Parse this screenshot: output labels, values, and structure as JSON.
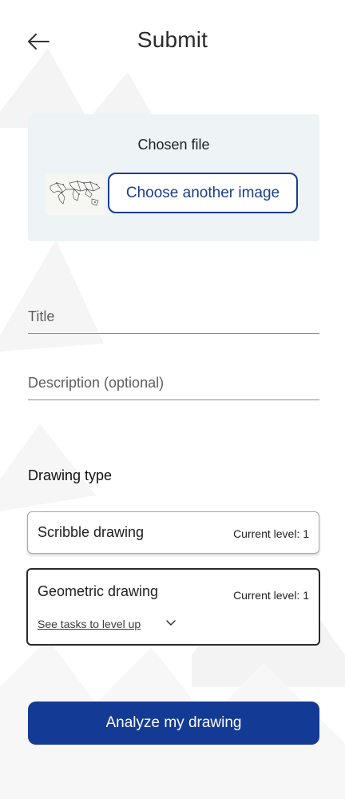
{
  "header": {
    "title": "Submit",
    "back_icon": "arrow-left-icon"
  },
  "file_panel": {
    "label": "Chosen file",
    "thumbnail_icon": "world-map-thumbnail",
    "choose_button_label": "Choose another image"
  },
  "form": {
    "title_placeholder": "Title",
    "description_placeholder": "Description (optional)"
  },
  "drawing_type": {
    "label": "Drawing type",
    "options": [
      {
        "name": "Scribble drawing",
        "level": "Current level: 1",
        "selected": false
      },
      {
        "name": "Geometric drawing",
        "level": "Current level: 1",
        "selected": true,
        "tasks_link": "See tasks to level up",
        "expand_icon": "chevron-down-icon"
      }
    ]
  },
  "actions": {
    "analyze_label": "Analyze my drawing"
  },
  "colors": {
    "primary": "#133a94",
    "panel_bg": "#eef4f5",
    "text": "#1f1f1f"
  }
}
